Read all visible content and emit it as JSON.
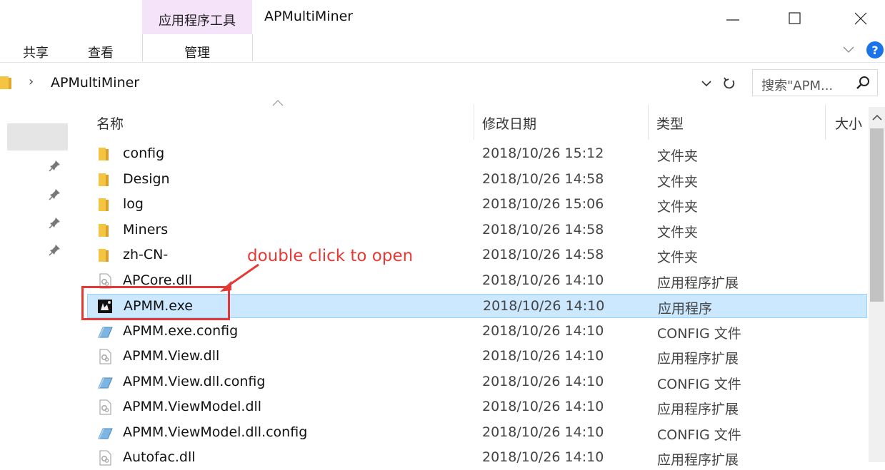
{
  "window": {
    "title": "APMultiMiner",
    "context_tab": "应用程序工具",
    "ribbon_tabs": [
      "共享",
      "查看",
      "管理"
    ]
  },
  "address": {
    "path": "APMultiMiner",
    "search_placeholder": "搜索\"APM..."
  },
  "columns": {
    "name": "名称",
    "date": "修改日期",
    "type": "类型",
    "size": "大小"
  },
  "files": [
    {
      "name": "config",
      "date": "2018/10/26 15:12",
      "type": "文件夹",
      "icon": "folder-icon"
    },
    {
      "name": "Design",
      "date": "2018/10/26 14:58",
      "type": "文件夹",
      "icon": "folder-icon"
    },
    {
      "name": "log",
      "date": "2018/10/26 15:06",
      "type": "文件夹",
      "icon": "folder-icon"
    },
    {
      "name": "Miners",
      "date": "2018/10/26 14:58",
      "type": "文件夹",
      "icon": "folder-icon"
    },
    {
      "name": "zh-CN-",
      "date": "2018/10/26 14:58",
      "type": "文件夹",
      "icon": "folder-icon"
    },
    {
      "name": "APCore.dll",
      "date": "2018/10/26 14:10",
      "type": "应用程序扩展",
      "icon": "dll-icon"
    },
    {
      "name": "APMM.exe",
      "date": "2018/10/26 14:10",
      "type": "应用程序",
      "icon": "exe-icon",
      "selected": true
    },
    {
      "name": "APMM.exe.config",
      "date": "2018/10/26 14:10",
      "type": "CONFIG 文件",
      "icon": "config-icon"
    },
    {
      "name": "APMM.View.dll",
      "date": "2018/10/26 14:10",
      "type": "应用程序扩展",
      "icon": "dll-icon"
    },
    {
      "name": "APMM.View.dll.config",
      "date": "2018/10/26 14:10",
      "type": "CONFIG 文件",
      "icon": "config-icon"
    },
    {
      "name": "APMM.ViewModel.dll",
      "date": "2018/10/26 14:10",
      "type": "应用程序扩展",
      "icon": "dll-icon"
    },
    {
      "name": "APMM.ViewModel.dll.config",
      "date": "2018/10/26 14:10",
      "type": "CONFIG 文件",
      "icon": "config-icon"
    },
    {
      "name": "Autofac.dll",
      "date": "2018/10/26 14:10",
      "type": "应用程序扩展",
      "icon": "dll-icon"
    }
  ],
  "annotation": {
    "text": "double click to open",
    "color": "#e53935"
  },
  "colors": {
    "context_tab_bg": "#f4e3f9",
    "selection_bg": "#cce8ff",
    "folder": "#f4c542"
  }
}
